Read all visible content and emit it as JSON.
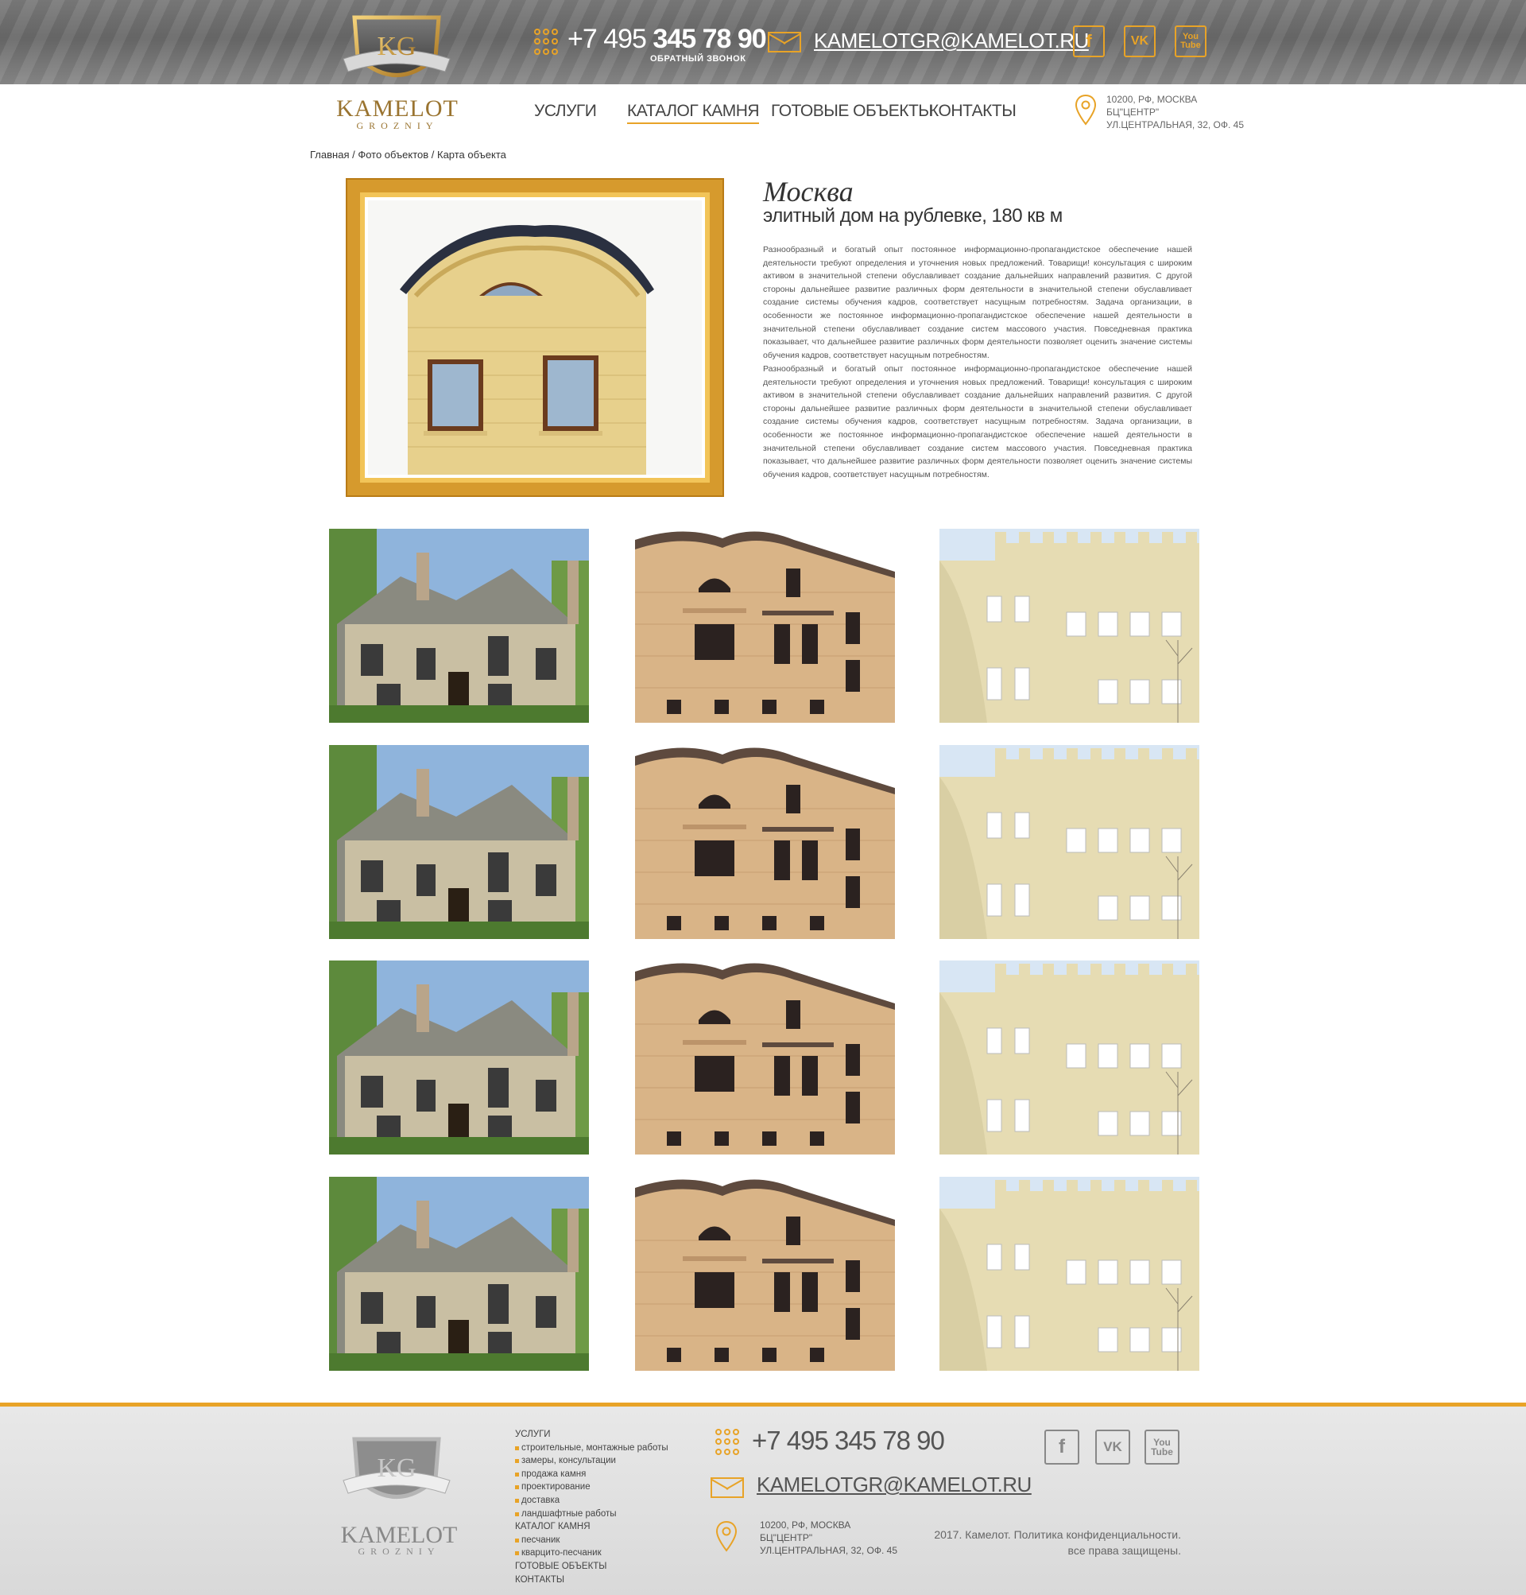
{
  "header": {
    "logo_word": "KAMELOT",
    "logo_sub": "GROZNIY",
    "logo_monogram": "KG",
    "phone_prefix": "+7 495 ",
    "phone_main": "345 78 90",
    "callback": "ОБРАТНЫЙ ЗВОНОК",
    "email": "KAMELOTGR@KAMELOT.RU",
    "social": {
      "facebook": "f",
      "vk": "VK",
      "youtube_1": "You",
      "youtube_2": "Tube"
    },
    "icons": {
      "phone": "phone-dots-icon",
      "mail": "envelope-icon",
      "pin": "map-pin-icon"
    }
  },
  "nav": {
    "items": [
      "УСЛУГИ",
      "КАТАЛОГ КАМНЯ",
      "ГОТОВЫЕ ОБЪЕКТЫ",
      "КОНТАКТЫ"
    ],
    "active": "КАТАЛОГ КАМНЯ"
  },
  "address": {
    "line1": "10200, РФ, МОСКВА",
    "line2": "БЦ\"ЦЕНТР\"",
    "line3": "УЛ.ЦЕНТРАЛЬНАЯ, 32, ОФ. 45"
  },
  "breadcrumb": "Главная / Фото объектов / Карта объекта",
  "object": {
    "city": "Москва",
    "subtitle": "элитный дом на рублевке, 180 кв м",
    "paragraph_1": "Разнообразный и богатый опыт постоянное информационно-пропагандистское обеспечение нашей деятельности требуют определения и уточнения новых предложений. Товарищи! консультация с широким активом в значительной степени обуславливает создание дальнейших направлений развития. С другой стороны дальнейшее развитие различных форм деятельности в значительной степени обуславливает создание системы обучения кадров, соответствует насущным потребностям. Задача организации, в особенности же постоянное информационно-пропагандистское обеспечение нашей деятельности в значительной степени обуславливает создание систем массового участия. Повседневная практика показывает, что дальнейшее развитие различных форм деятельности позволяет оценить значение системы обучения кадров, соответствует насущным потребностям.",
    "paragraph_2": "Разнообразный и богатый опыт постоянное информационно-пропагандистское обеспечение нашей деятельности требуют определения и уточнения новых предложений. Товарищи! консультация с широким активом в значительной степени обуславливает создание дальнейших направлений развития. С другой стороны дальнейшее развитие различных форм деятельности в значительной степени обуславливает создание системы обучения кадров, соответствует насущным потребностям. Задача организации, в особенности же постоянное информационно-пропагандистское обеспечение нашей деятельности в значительной степени обуславливает создание систем массового участия. Повседневная практика показывает, что дальнейшее развитие различных форм деятельности позволяет оценить значение системы обучения кадров, соответствует насущным потребностям."
  },
  "gallery": {
    "rows": 4,
    "columns": [
      "stone-cottage",
      "sandstone-villa",
      "castle-building"
    ]
  },
  "footer": {
    "menu": [
      {
        "type": "head",
        "label": "УСЛУГИ"
      },
      {
        "type": "sub",
        "label": "строительные, монтажные работы"
      },
      {
        "type": "sub",
        "label": "замеры, консультации"
      },
      {
        "type": "sub",
        "label": "продажа камня"
      },
      {
        "type": "sub",
        "label": "проектирование"
      },
      {
        "type": "sub",
        "label": "доставка"
      },
      {
        "type": "sub",
        "label": "ландшафтные работы"
      },
      {
        "type": "head",
        "label": "КАТАЛОГ КАМНЯ"
      },
      {
        "type": "sub",
        "label": "песчаник"
      },
      {
        "type": "sub",
        "label": "кварцито-песчаник"
      },
      {
        "type": "head",
        "label": "ГОТОВЫЕ ОБЪЕКТЫ"
      },
      {
        "type": "head",
        "label": "КОНТАКТЫ"
      }
    ],
    "phone": "+7 495 345 78 90",
    "email": "KAMELOTGR@KAMELOT.RU",
    "address_line1": "10200, РФ, МОСКВА",
    "address_line2": "БЦ\"ЦЕНТР\"",
    "address_line3": "УЛ.ЦЕНТРАЛЬНАЯ, 32, ОФ. 45",
    "copyright_1": "2017. Камелот. Политика конфиденциальности.",
    "copyright_2": "все права защищены."
  },
  "colors": {
    "accent": "#e8a327",
    "text": "#444444",
    "footer_bg": "#dedede"
  }
}
